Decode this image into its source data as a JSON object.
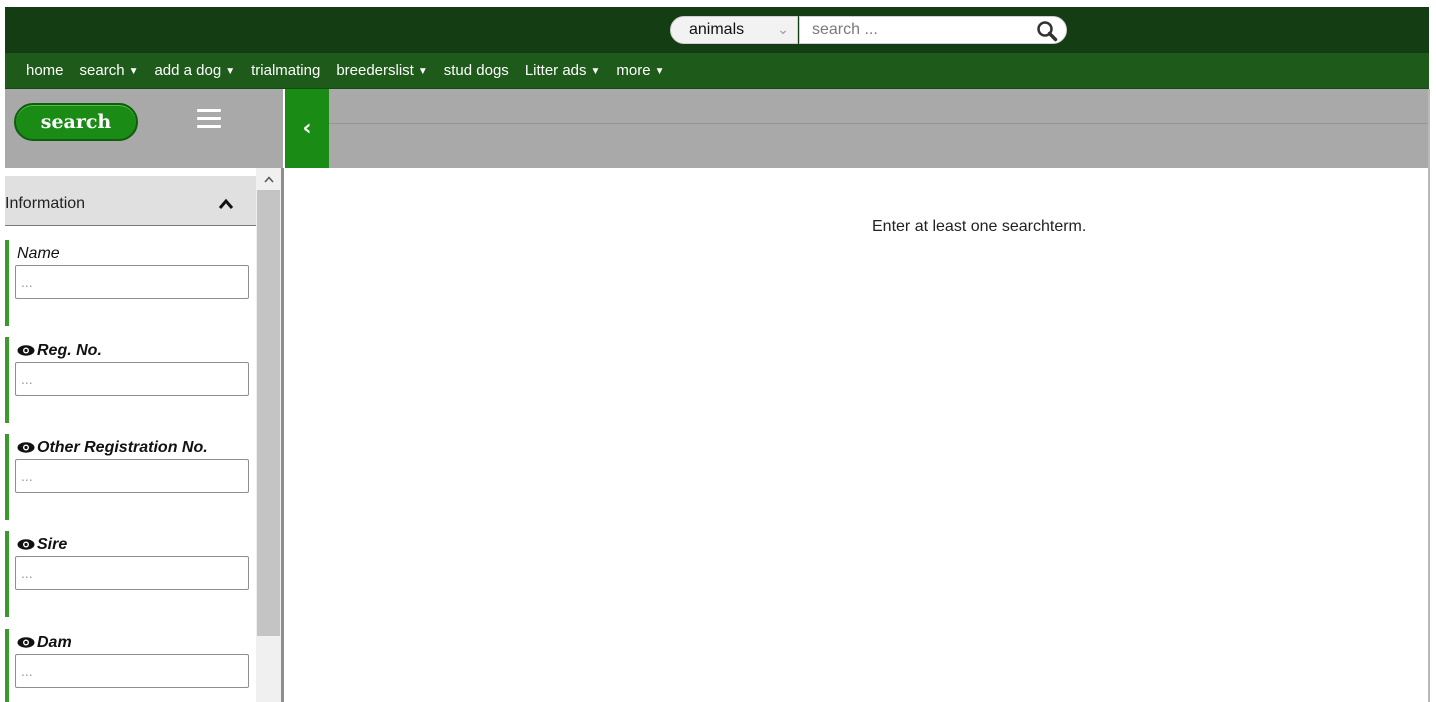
{
  "topbar": {
    "scope_selector": "animals",
    "search_placeholder": "search ..."
  },
  "nav": {
    "items": [
      {
        "label": "home",
        "dropdown": false
      },
      {
        "label": "search",
        "dropdown": true
      },
      {
        "label": "add a dog",
        "dropdown": true
      },
      {
        "label": "trialmating",
        "dropdown": false
      },
      {
        "label": "breederslist",
        "dropdown": true
      },
      {
        "label": "stud dogs",
        "dropdown": false
      },
      {
        "label": "Litter ads",
        "dropdown": true
      },
      {
        "label": "more",
        "dropdown": true
      }
    ],
    "caret": "▼"
  },
  "sidebar": {
    "search_button": "search",
    "section_title": "Information",
    "fields": [
      {
        "label": "Name",
        "placeholder": "...",
        "has_eye": false,
        "bold": false
      },
      {
        "label": "Reg. No.",
        "placeholder": "...",
        "has_eye": true,
        "bold": true
      },
      {
        "label": "Other Registration No.",
        "placeholder": "...",
        "has_eye": true,
        "bold": true
      },
      {
        "label": "Sire",
        "placeholder": "...",
        "has_eye": true,
        "bold": true
      },
      {
        "label": "Dam",
        "placeholder": "...",
        "has_eye": true,
        "bold": true
      }
    ]
  },
  "main": {
    "message": "Enter at least one searchterm."
  },
  "colors": {
    "topbar": "#153d14",
    "navbar": "#1e5a1a",
    "accent_green": "#1a8c16",
    "header_gray": "#a9a9a9"
  },
  "icons": [
    "search-icon",
    "hamburger-icon",
    "chevron-left-icon",
    "chevron-up-icon",
    "eye-icon",
    "chevron-down-icon"
  ]
}
